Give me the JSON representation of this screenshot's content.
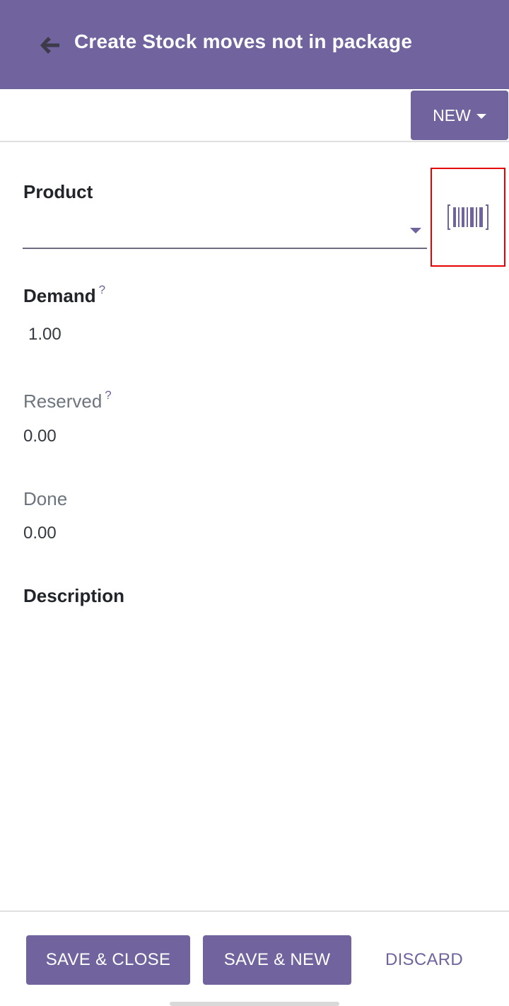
{
  "header": {
    "title": "Create Stock moves not in package",
    "back_icon": "arrow-left-icon"
  },
  "control_panel": {
    "new_label": "NEW"
  },
  "form": {
    "product": {
      "label": "Product",
      "value": "",
      "barcode_icon": "barcode-icon"
    },
    "demand": {
      "label": "Demand",
      "help": "?",
      "value": "1.00"
    },
    "reserved": {
      "label": "Reserved",
      "help": "?",
      "value": "0.00"
    },
    "done": {
      "label": "Done",
      "value": "0.00"
    },
    "description": {
      "label": "Description",
      "value": ""
    }
  },
  "footer": {
    "save_close_label": "SAVE & CLOSE",
    "save_new_label": "SAVE & NEW",
    "discard_label": "DISCARD"
  },
  "colors": {
    "brand": "#71639e",
    "highlight": "#e60000"
  }
}
